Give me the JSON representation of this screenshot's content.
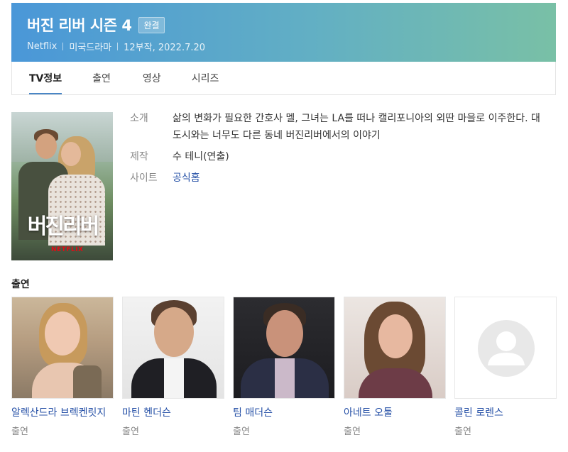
{
  "header": {
    "title": "버진 리버 시즌 4",
    "badge": "완결",
    "network": "Netflix",
    "genre": "미국드라마",
    "episodes_date": "12부작, 2022.7.20"
  },
  "tabs": [
    {
      "label": "TV정보",
      "active": true
    },
    {
      "label": "출연",
      "active": false
    },
    {
      "label": "영상",
      "active": false
    },
    {
      "label": "시리즈",
      "active": false
    }
  ],
  "poster": {
    "title_text": "버진리버",
    "brand": "NETFLIX"
  },
  "info": {
    "synopsis_label": "소개",
    "synopsis_value": "삶의 변화가 필요한 간호사 멜, 그녀는 LA를 떠나 캘리포니아의 외딴 마을로 이주한다. 대도시와는 너무도 다른 동네 버진리버에서의 이야기",
    "production_label": "제작",
    "production_value": "수 테니(연출)",
    "site_label": "사이트",
    "site_value": "공식홈"
  },
  "cast_section": {
    "title": "출연",
    "members": [
      {
        "name": "알렉산드라 브렉켄릿지",
        "role": "출연",
        "icon": "actor-photo"
      },
      {
        "name": "마틴 헨더슨",
        "role": "출연",
        "icon": "actor-photo"
      },
      {
        "name": "팀 매더슨",
        "role": "출연",
        "icon": "actor-photo"
      },
      {
        "name": "아네트 오툴",
        "role": "출연",
        "icon": "actor-photo"
      },
      {
        "name": "콜린 로렌스",
        "role": "출연",
        "icon": "default-avatar-icon"
      }
    ]
  },
  "colors": {
    "header_gradient_start": "#4a97d8",
    "header_gradient_end": "#79c0a6",
    "link": "#244fa6",
    "active_tab_underline": "#4a86c6"
  }
}
